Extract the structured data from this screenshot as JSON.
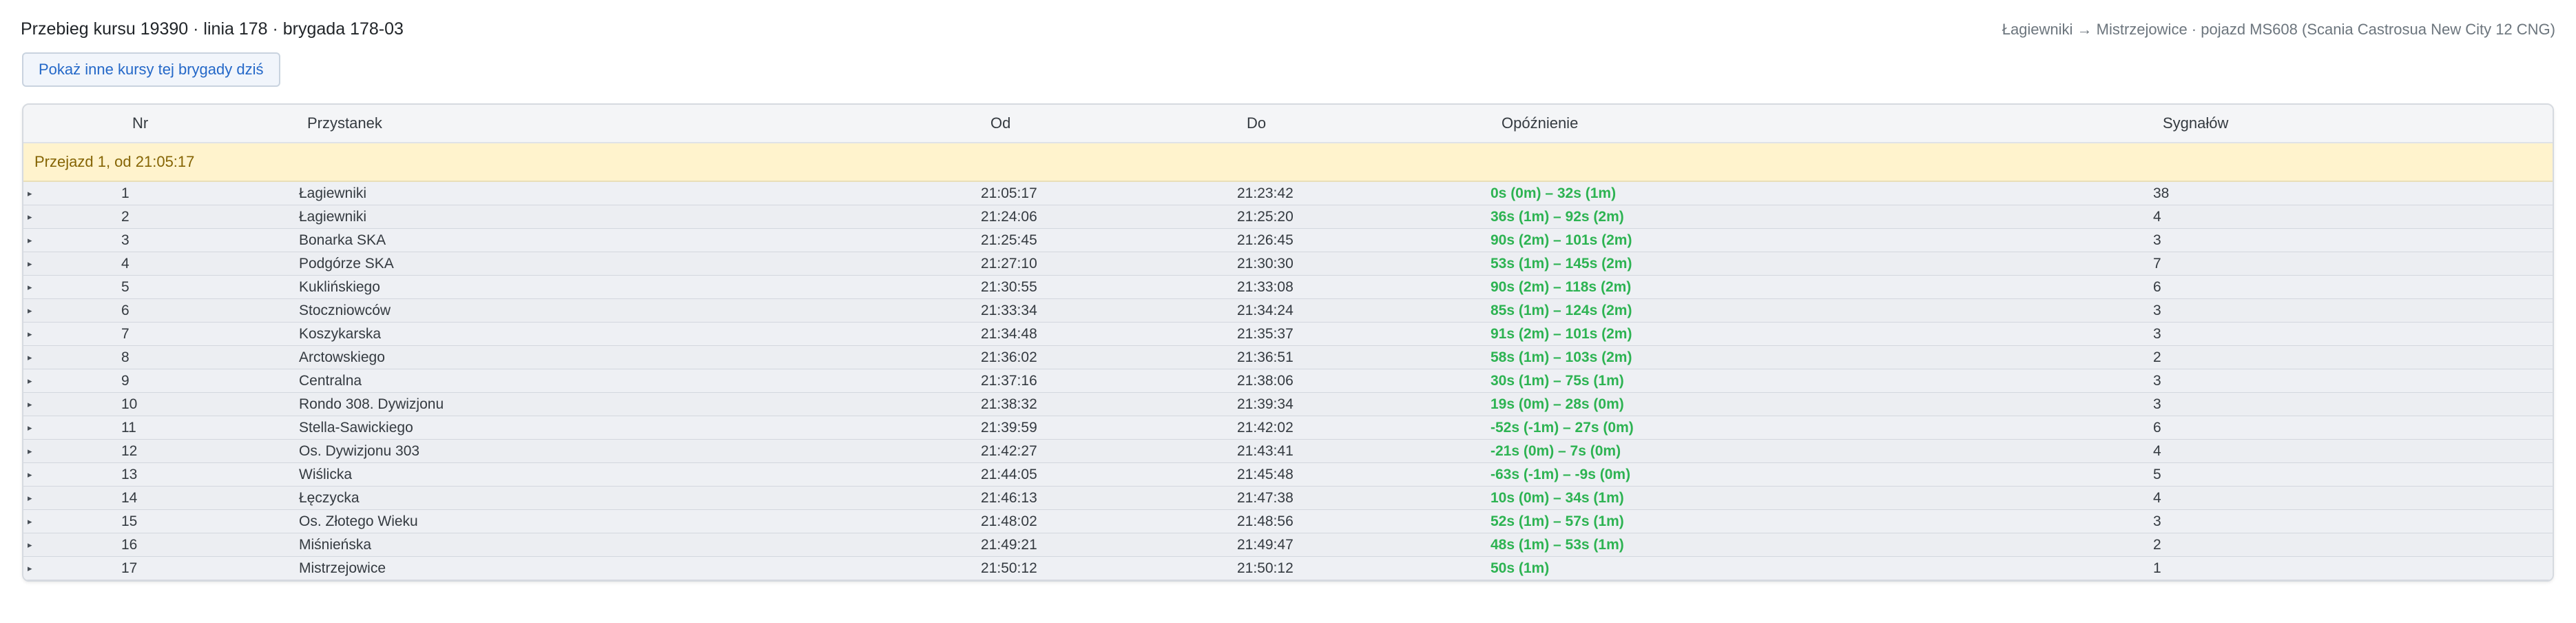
{
  "header": {
    "title": "Przebieg kursu 19390 · linia 178 · brygada 178-03",
    "vehicle_info": "Łagiewniki → Mistrzejowice · pojazd MS608 (Scania Castrosua New City 12 CNG)"
  },
  "actions": {
    "other_courses_label": "Pokaż inne kursy tej brygady dziś"
  },
  "table": {
    "columns": {
      "nr": "Nr",
      "stop": "Przystanek",
      "from": "Od",
      "to": "Do",
      "delay": "Opóźnienie",
      "signals": "Sygnałów"
    },
    "group_label": "Przejazd 1, od 21:05:17",
    "expander_icon": "▸",
    "rows": [
      {
        "nr": "1",
        "stop": "Łagiewniki",
        "from": "21:05:17",
        "to": "21:23:42",
        "delay": "0s (0m) – 32s (1m)",
        "signals": "38"
      },
      {
        "nr": "2",
        "stop": "Łagiewniki",
        "from": "21:24:06",
        "to": "21:25:20",
        "delay": "36s (1m) – 92s (2m)",
        "signals": "4"
      },
      {
        "nr": "3",
        "stop": "Bonarka SKA",
        "from": "21:25:45",
        "to": "21:26:45",
        "delay": "90s (2m) – 101s (2m)",
        "signals": "3"
      },
      {
        "nr": "4",
        "stop": "Podgórze SKA",
        "from": "21:27:10",
        "to": "21:30:30",
        "delay": "53s (1m) – 145s (2m)",
        "signals": "7"
      },
      {
        "nr": "5",
        "stop": "Kuklińskiego",
        "from": "21:30:55",
        "to": "21:33:08",
        "delay": "90s (2m) – 118s (2m)",
        "signals": "6"
      },
      {
        "nr": "6",
        "stop": "Stoczniowców",
        "from": "21:33:34",
        "to": "21:34:24",
        "delay": "85s (1m) – 124s (2m)",
        "signals": "3"
      },
      {
        "nr": "7",
        "stop": "Koszykarska",
        "from": "21:34:48",
        "to": "21:35:37",
        "delay": "91s (2m) – 101s (2m)",
        "signals": "3"
      },
      {
        "nr": "8",
        "stop": "Arctowskiego",
        "from": "21:36:02",
        "to": "21:36:51",
        "delay": "58s (1m) – 103s (2m)",
        "signals": "2"
      },
      {
        "nr": "9",
        "stop": "Centralna",
        "from": "21:37:16",
        "to": "21:38:06",
        "delay": "30s (1m) – 75s (1m)",
        "signals": "3"
      },
      {
        "nr": "10",
        "stop": "Rondo 308. Dywizjonu",
        "from": "21:38:32",
        "to": "21:39:34",
        "delay": "19s (0m) – 28s (0m)",
        "signals": "3"
      },
      {
        "nr": "11",
        "stop": "Stella-Sawickiego",
        "from": "21:39:59",
        "to": "21:42:02",
        "delay": "-52s (-1m) – 27s (0m)",
        "signals": "6"
      },
      {
        "nr": "12",
        "stop": "Os. Dywizjonu 303",
        "from": "21:42:27",
        "to": "21:43:41",
        "delay": "-21s (0m) – 7s (0m)",
        "signals": "4"
      },
      {
        "nr": "13",
        "stop": "Wiślicka",
        "from": "21:44:05",
        "to": "21:45:48",
        "delay": "-63s (-1m) – -9s (0m)",
        "signals": "5"
      },
      {
        "nr": "14",
        "stop": "Łęczycka",
        "from": "21:46:13",
        "to": "21:47:38",
        "delay": "10s (0m) – 34s (1m)",
        "signals": "4"
      },
      {
        "nr": "15",
        "stop": "Os. Złotego Wieku",
        "from": "21:48:02",
        "to": "21:48:56",
        "delay": "52s (1m) – 57s (1m)",
        "signals": "3"
      },
      {
        "nr": "16",
        "stop": "Miśnieńska",
        "from": "21:49:21",
        "to": "21:49:47",
        "delay": "48s (1m) – 53s (1m)",
        "signals": "2"
      },
      {
        "nr": "17",
        "stop": "Mistrzejowice",
        "from": "21:50:12",
        "to": "21:50:12",
        "delay": "50s (1m)",
        "signals": "1"
      }
    ]
  },
  "colors": {
    "delay_text": "#2db352",
    "group_background": "#fff3cd",
    "group_text": "#856404",
    "button_text": "#2468c8"
  }
}
